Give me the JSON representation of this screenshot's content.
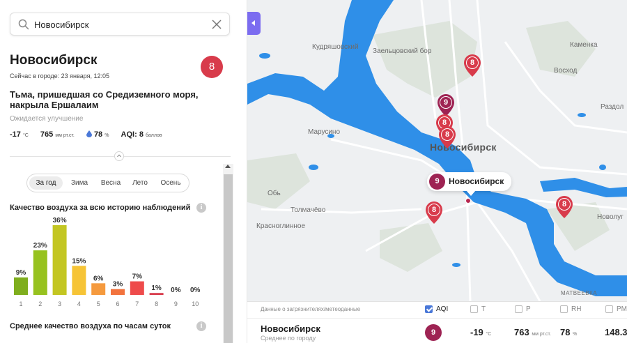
{
  "search": {
    "value": "Новосибирск"
  },
  "city": {
    "name": "Новосибирск",
    "time": "Сейчас в городе: 23 января, 12:05",
    "aqi": "8",
    "aqi_color": "#d83b4b",
    "headline": "Тьма, пришедшая со Средиземного моря, накрыла Ершалаим",
    "forecast": "Ожидается улучшение",
    "temp": "-17",
    "temp_unit": "°C",
    "pressure": "765",
    "pressure_unit": "мм рт.ст.",
    "humidity": "78",
    "humidity_unit": "%",
    "aqi_line_label": "AQI:",
    "aqi_line_value": "8",
    "aqi_line_unit": "баллов"
  },
  "seasons": [
    "За год",
    "Зима",
    "Весна",
    "Лето",
    "Осень"
  ],
  "history_title": "Качество воздуха за всю историю наблюдений",
  "hourly_title": "Среднее качество воздуха по часам суток",
  "info_glyph": "i",
  "chart_data": {
    "type": "bar",
    "categories": [
      "1",
      "2",
      "3",
      "4",
      "5",
      "6",
      "7",
      "8",
      "9",
      "10"
    ],
    "values": [
      9,
      23,
      36,
      15,
      6,
      3,
      7,
      1,
      0,
      0
    ],
    "labels": [
      "9%",
      "23%",
      "36%",
      "15%",
      "6%",
      "3%",
      "7%",
      "1%",
      "0%",
      "0%"
    ],
    "colors": [
      "#7fae1e",
      "#97c21f",
      "#c3c622",
      "#f6c436",
      "#f59a3e",
      "#f2733e",
      "#ee4b4b",
      "#d83b4b",
      "#b0305a",
      "#8a2a5e"
    ],
    "ylim": [
      0,
      36
    ]
  },
  "map": {
    "labels": {
      "kudryash": "Кудряшовский",
      "zaeltsovsky": "Заельцовский бор",
      "kamenka": "Каменка",
      "voskhod": "Восход",
      "razdol": "Раздол",
      "marusino": "Марусино",
      "city": "Новосибирск",
      "ob": "Обь",
      "tolmachevo": "Толмачёво",
      "krasnoglinnoe": "Красноглинное",
      "novolug": "Новолуг",
      "matveevka": "МАТВЕЕВКА"
    },
    "callout": {
      "aqi": "9",
      "name": "Новосибирск"
    },
    "pins": [
      {
        "value": "8",
        "color": "#d83b4b"
      },
      {
        "value": "9",
        "color": "#9e2353"
      },
      {
        "value": "8",
        "color": "#d83b4b"
      },
      {
        "value": "8",
        "color": "#d83b4b"
      },
      {
        "value": "8",
        "color": "#d83b4b"
      },
      {
        "value": "8",
        "color": "#d83b4b"
      }
    ]
  },
  "table": {
    "label": "Данные о загрязнителях/метеоданные",
    "columns": [
      {
        "label": "AQI",
        "checked": true
      },
      {
        "label": "T",
        "checked": false
      },
      {
        "label": "P",
        "checked": false
      },
      {
        "label": "RH",
        "checked": false
      },
      {
        "label": "PM",
        "checked": false
      }
    ],
    "row": {
      "city": "Новосибирск",
      "sub": "Среднее по городу",
      "aqi": "9",
      "temp": "-19",
      "temp_unit": "°C",
      "pressure": "763",
      "pressure_unit": "мм рт.ст.",
      "humidity": "78",
      "humidity_unit": "%",
      "pm": "148.3"
    }
  },
  "colors": {
    "accent": "#7b6cf0",
    "water": "#2f8fe8",
    "road": "#ffffff",
    "map_bg": "#eef0f2"
  }
}
